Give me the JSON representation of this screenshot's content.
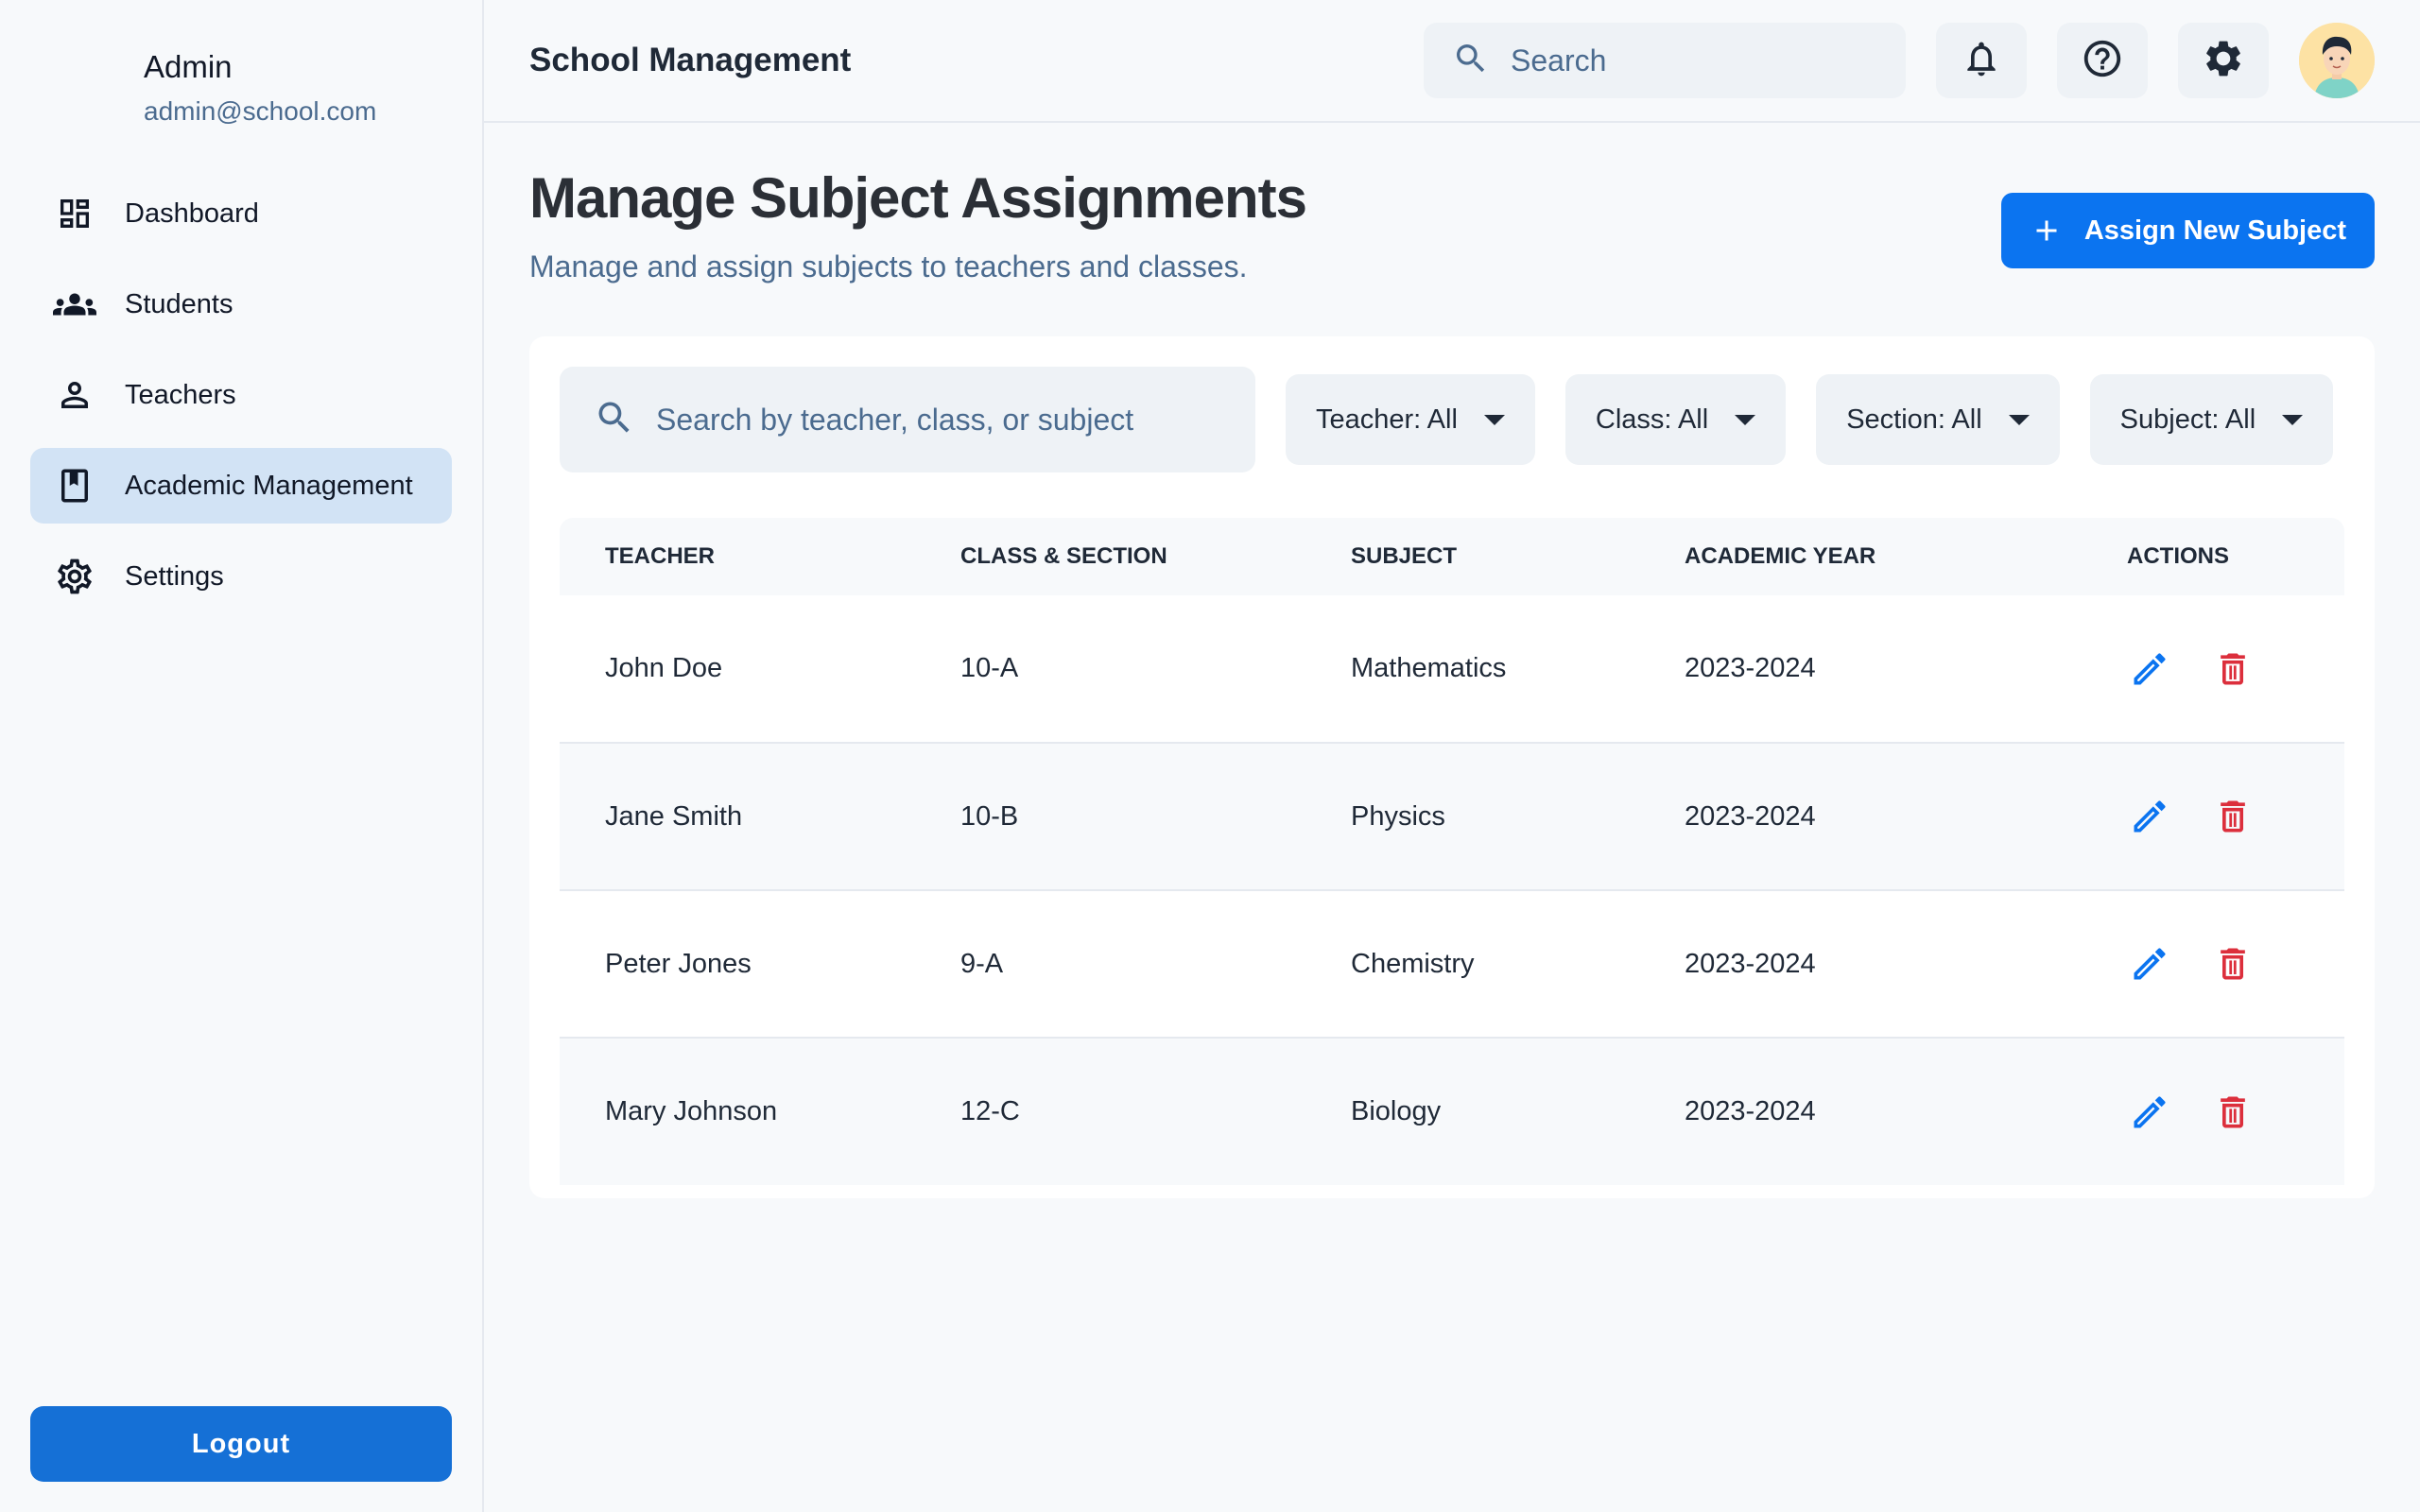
{
  "profile": {
    "name": "Admin",
    "email": "admin@school.com"
  },
  "sidebar": {
    "items": [
      {
        "label": "Dashboard",
        "icon": "dashboard-icon"
      },
      {
        "label": "Students",
        "icon": "students-icon"
      },
      {
        "label": "Teachers",
        "icon": "person-icon"
      },
      {
        "label": "Academic Management",
        "icon": "book-icon",
        "active": true
      },
      {
        "label": "Settings",
        "icon": "gear-icon"
      }
    ],
    "logout_label": "Logout"
  },
  "header": {
    "title": "School Management",
    "search_placeholder": "Search"
  },
  "page": {
    "title": "Manage Subject Assignments",
    "subtitle": "Manage and assign subjects to teachers and classes.",
    "assign_button": "Assign New Subject"
  },
  "filters": {
    "search_placeholder": "Search by teacher, class, or subject",
    "teacher": "Teacher: All",
    "class": "Class: All",
    "section": "Section: All",
    "subject": "Subject: All"
  },
  "table": {
    "columns": [
      "TEACHER",
      "CLASS & SECTION",
      "SUBJECT",
      "ACADEMIC YEAR",
      "ACTIONS"
    ],
    "rows": [
      {
        "teacher": "John Doe",
        "class_section": "10-A",
        "subject": "Mathematics",
        "year": "2023-2024"
      },
      {
        "teacher": "Jane Smith",
        "class_section": "10-B",
        "subject": "Physics",
        "year": "2023-2024"
      },
      {
        "teacher": "Peter Jones",
        "class_section": "9-A",
        "subject": "Chemistry",
        "year": "2023-2024"
      },
      {
        "teacher": "Mary Johnson",
        "class_section": "12-C",
        "subject": "Biology",
        "year": "2023-2024"
      }
    ]
  },
  "colors": {
    "primary": "#0b74f0",
    "logout": "#1570d6",
    "active_nav": "#d2e3f5",
    "edit_icon": "#0b74f0",
    "delete_icon": "#dc2f3c"
  }
}
